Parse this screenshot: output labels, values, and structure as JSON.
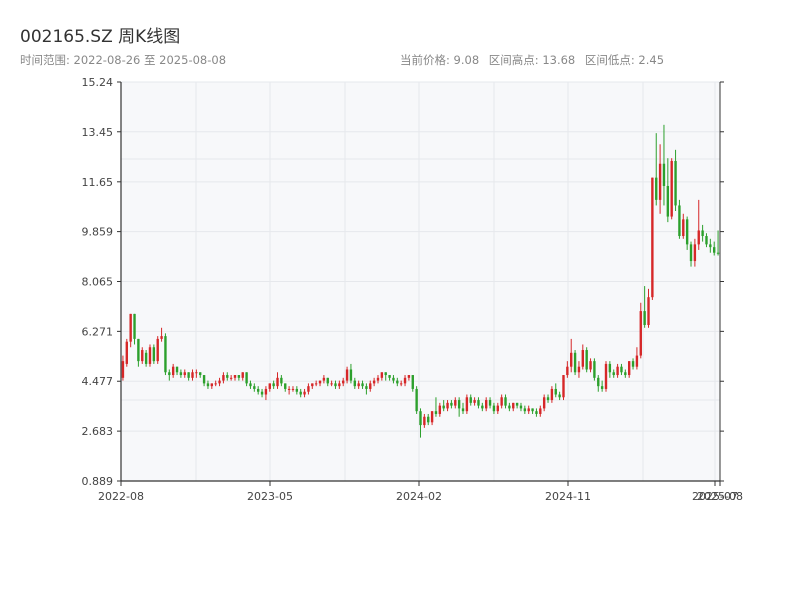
{
  "header": {
    "title": "002165.SZ 周K线图",
    "range_text": "时间范围: 2022-08-26 至 2025-08-08",
    "current_price": "当前价格: 9.08",
    "range_high": "区间高点: 13.68",
    "range_low": "区间低点: 2.45"
  },
  "colors": {
    "up": "#d62728",
    "down": "#2ca02c",
    "grid": "#e6e8ec",
    "plot_bg": "#f7f8fa",
    "axis": "#333333"
  },
  "chart_data": {
    "type": "candlestick",
    "title": "002165.SZ 周K线图",
    "x_ticks": [
      "2022-08",
      "2023-05",
      "2024-02",
      "2024-11",
      "2025-07",
      "2025-08"
    ],
    "y_ticks": [
      "0.889",
      "2.683",
      "4.477",
      "6.271",
      "8.065",
      "9.859",
      "11.65",
      "13.45",
      "15.24"
    ],
    "ylim": [
      0.889,
      15.24
    ],
    "grid": true,
    "series": [
      {
        "values": [
          [
            4.6,
            5.2,
            5.4,
            4.5
          ],
          [
            5.1,
            5.9,
            6.0,
            5.0
          ],
          [
            5.9,
            6.9,
            6.9,
            5.7
          ],
          [
            6.9,
            6.0,
            6.9,
            5.8
          ],
          [
            6.0,
            5.2,
            6.0,
            5.0
          ],
          [
            5.2,
            5.6,
            5.7,
            5.1
          ],
          [
            5.5,
            5.1,
            5.6,
            5.0
          ],
          [
            5.1,
            5.7,
            5.8,
            5.0
          ],
          [
            5.7,
            5.2,
            5.8,
            5.1
          ],
          [
            5.2,
            6.0,
            6.1,
            5.1
          ],
          [
            6.0,
            6.1,
            6.4,
            5.9
          ],
          [
            6.1,
            4.8,
            6.2,
            4.7
          ],
          [
            4.8,
            4.7,
            4.9,
            4.5
          ],
          [
            4.7,
            5.0,
            5.1,
            4.6
          ],
          [
            5.0,
            4.8,
            5.0,
            4.7
          ],
          [
            4.8,
            4.7,
            4.9,
            4.6
          ],
          [
            4.7,
            4.8,
            4.9,
            4.6
          ],
          [
            4.8,
            4.6,
            4.8,
            4.5
          ],
          [
            4.6,
            4.8,
            4.9,
            4.5
          ],
          [
            4.8,
            4.8,
            4.9,
            4.6
          ],
          [
            4.8,
            4.7,
            4.8,
            4.6
          ],
          [
            4.7,
            4.4,
            4.7,
            4.3
          ],
          [
            4.4,
            4.3,
            4.5,
            4.2
          ],
          [
            4.3,
            4.4,
            4.4,
            4.2
          ],
          [
            4.4,
            4.4,
            4.5,
            4.3
          ],
          [
            4.4,
            4.5,
            4.6,
            4.3
          ],
          [
            4.5,
            4.7,
            4.8,
            4.4
          ],
          [
            4.7,
            4.6,
            4.8,
            4.5
          ],
          [
            4.6,
            4.6,
            4.7,
            4.5
          ],
          [
            4.6,
            4.7,
            4.7,
            4.5
          ],
          [
            4.7,
            4.6,
            4.7,
            4.5
          ],
          [
            4.6,
            4.8,
            4.8,
            4.5
          ],
          [
            4.8,
            4.4,
            4.8,
            4.3
          ],
          [
            4.4,
            4.3,
            4.5,
            4.2
          ],
          [
            4.3,
            4.2,
            4.4,
            4.1
          ],
          [
            4.2,
            4.1,
            4.3,
            4.0
          ],
          [
            4.1,
            4.0,
            4.2,
            3.9
          ],
          [
            4.0,
            4.2,
            4.3,
            3.8
          ],
          [
            4.2,
            4.4,
            4.4,
            4.1
          ],
          [
            4.4,
            4.3,
            4.5,
            4.2
          ],
          [
            4.3,
            4.6,
            4.8,
            4.2
          ],
          [
            4.6,
            4.4,
            4.7,
            4.3
          ],
          [
            4.4,
            4.2,
            4.4,
            4.1
          ],
          [
            4.2,
            4.2,
            4.3,
            4.0
          ],
          [
            4.2,
            4.2,
            4.3,
            4.1
          ],
          [
            4.2,
            4.1,
            4.3,
            4.0
          ],
          [
            4.1,
            4.0,
            4.2,
            3.9
          ],
          [
            4.0,
            4.1,
            4.2,
            3.9
          ],
          [
            4.1,
            4.3,
            4.4,
            4.0
          ],
          [
            4.3,
            4.4,
            4.4,
            4.2
          ],
          [
            4.4,
            4.4,
            4.5,
            4.3
          ],
          [
            4.4,
            4.5,
            4.5,
            4.3
          ],
          [
            4.5,
            4.6,
            4.7,
            4.4
          ],
          [
            4.6,
            4.4,
            4.6,
            4.3
          ],
          [
            4.4,
            4.4,
            4.5,
            4.3
          ],
          [
            4.4,
            4.3,
            4.5,
            4.2
          ],
          [
            4.3,
            4.4,
            4.5,
            4.2
          ],
          [
            4.4,
            4.5,
            4.6,
            4.3
          ],
          [
            4.5,
            4.9,
            5.0,
            4.4
          ],
          [
            4.9,
            4.5,
            5.1,
            4.4
          ],
          [
            4.5,
            4.3,
            4.6,
            4.2
          ],
          [
            4.3,
            4.4,
            4.5,
            4.2
          ],
          [
            4.4,
            4.3,
            4.5,
            4.2
          ],
          [
            4.3,
            4.2,
            4.4,
            4.0
          ],
          [
            4.2,
            4.4,
            4.5,
            4.1
          ],
          [
            4.4,
            4.5,
            4.6,
            4.3
          ],
          [
            4.5,
            4.6,
            4.7,
            4.4
          ],
          [
            4.6,
            4.8,
            4.8,
            4.5
          ],
          [
            4.8,
            4.7,
            4.8,
            4.5
          ],
          [
            4.7,
            4.6,
            4.7,
            4.5
          ],
          [
            4.6,
            4.5,
            4.7,
            4.4
          ],
          [
            4.5,
            4.4,
            4.6,
            4.3
          ],
          [
            4.4,
            4.4,
            4.5,
            4.3
          ],
          [
            4.4,
            4.6,
            4.7,
            4.3
          ],
          [
            4.6,
            4.7,
            4.7,
            4.5
          ],
          [
            4.7,
            4.2,
            4.7,
            4.1
          ],
          [
            4.2,
            3.4,
            4.3,
            3.3
          ],
          [
            3.4,
            2.9,
            3.5,
            2.45
          ],
          [
            2.9,
            3.2,
            3.3,
            2.8
          ],
          [
            3.2,
            3.0,
            3.3,
            2.9
          ],
          [
            3.0,
            3.4,
            3.4,
            2.9
          ],
          [
            3.4,
            3.3,
            3.9,
            3.2
          ],
          [
            3.3,
            3.6,
            3.7,
            3.2
          ],
          [
            3.6,
            3.5,
            3.8,
            3.4
          ],
          [
            3.5,
            3.7,
            3.8,
            3.4
          ],
          [
            3.7,
            3.6,
            3.8,
            3.5
          ],
          [
            3.6,
            3.8,
            3.9,
            3.5
          ],
          [
            3.8,
            3.5,
            3.9,
            3.2
          ],
          [
            3.5,
            3.4,
            3.7,
            3.3
          ],
          [
            3.4,
            3.9,
            4.0,
            3.3
          ],
          [
            3.9,
            3.7,
            4.0,
            3.6
          ],
          [
            3.7,
            3.8,
            3.9,
            3.6
          ],
          [
            3.8,
            3.6,
            3.9,
            3.5
          ],
          [
            3.6,
            3.5,
            3.7,
            3.4
          ],
          [
            3.5,
            3.8,
            3.9,
            3.4
          ],
          [
            3.8,
            3.6,
            3.9,
            3.5
          ],
          [
            3.6,
            3.4,
            3.7,
            3.3
          ],
          [
            3.4,
            3.6,
            3.7,
            3.3
          ],
          [
            3.6,
            3.9,
            4.0,
            3.5
          ],
          [
            3.9,
            3.6,
            4.0,
            3.5
          ],
          [
            3.6,
            3.5,
            3.7,
            3.4
          ],
          [
            3.5,
            3.7,
            3.7,
            3.4
          ],
          [
            3.7,
            3.6,
            3.7,
            3.5
          ],
          [
            3.6,
            3.5,
            3.7,
            3.4
          ],
          [
            3.5,
            3.4,
            3.6,
            3.3
          ],
          [
            3.4,
            3.5,
            3.6,
            3.3
          ],
          [
            3.5,
            3.4,
            3.5,
            3.3
          ],
          [
            3.4,
            3.3,
            3.5,
            3.2
          ],
          [
            3.3,
            3.5,
            3.6,
            3.2
          ],
          [
            3.5,
            3.9,
            4.0,
            3.4
          ],
          [
            3.9,
            3.8,
            4.0,
            3.7
          ],
          [
            3.8,
            4.2,
            4.3,
            3.7
          ],
          [
            4.2,
            4.0,
            4.4,
            3.9
          ],
          [
            4.0,
            3.9,
            4.1,
            3.8
          ],
          [
            3.9,
            4.7,
            4.7,
            3.8
          ],
          [
            4.7,
            5.0,
            5.2,
            4.6
          ],
          [
            5.0,
            5.5,
            6.0,
            4.8
          ],
          [
            5.5,
            4.8,
            5.6,
            4.7
          ],
          [
            4.8,
            5.0,
            5.2,
            4.6
          ],
          [
            5.0,
            5.6,
            5.8,
            4.9
          ],
          [
            5.6,
            4.9,
            5.7,
            4.8
          ],
          [
            4.9,
            5.2,
            5.3,
            4.8
          ],
          [
            5.2,
            4.6,
            5.3,
            4.5
          ],
          [
            4.6,
            4.3,
            4.7,
            4.1
          ],
          [
            4.3,
            4.2,
            4.5,
            4.1
          ],
          [
            4.2,
            5.1,
            5.2,
            4.1
          ],
          [
            5.1,
            4.8,
            5.2,
            4.6
          ],
          [
            4.8,
            4.7,
            4.9,
            4.6
          ],
          [
            4.7,
            5.0,
            5.1,
            4.6
          ],
          [
            5.0,
            4.8,
            5.1,
            4.7
          ],
          [
            4.8,
            4.7,
            4.9,
            4.6
          ],
          [
            4.7,
            5.2,
            5.2,
            4.6
          ],
          [
            5.2,
            5.0,
            5.3,
            4.9
          ],
          [
            5.0,
            5.4,
            5.7,
            4.9
          ],
          [
            5.4,
            7.0,
            7.3,
            5.3
          ],
          [
            7.0,
            6.5,
            7.9,
            6.4
          ],
          [
            6.5,
            7.5,
            7.8,
            6.4
          ],
          [
            7.5,
            11.8,
            11.8,
            7.4
          ],
          [
            11.8,
            11.0,
            13.4,
            10.8
          ],
          [
            11.0,
            12.3,
            13.0,
            10.5
          ],
          [
            12.3,
            11.5,
            13.7,
            10.8
          ],
          [
            11.5,
            10.4,
            12.5,
            10.2
          ],
          [
            10.4,
            12.4,
            12.5,
            10.3
          ],
          [
            12.4,
            10.8,
            12.8,
            10.6
          ],
          [
            10.8,
            9.7,
            11.0,
            9.6
          ],
          [
            9.7,
            10.3,
            10.5,
            9.6
          ],
          [
            10.3,
            9.4,
            10.4,
            9.2
          ],
          [
            9.4,
            8.8,
            9.5,
            8.6
          ],
          [
            8.8,
            9.4,
            9.6,
            8.6
          ],
          [
            9.4,
            9.9,
            11.0,
            9.2
          ],
          [
            9.9,
            9.7,
            10.1,
            9.5
          ],
          [
            9.7,
            9.4,
            9.8,
            9.3
          ],
          [
            9.4,
            9.3,
            9.6,
            9.1
          ],
          [
            9.3,
            9.1,
            9.5,
            9.0
          ],
          [
            9.1,
            9.08,
            9.9,
            9.0
          ]
        ]
      }
    ]
  }
}
